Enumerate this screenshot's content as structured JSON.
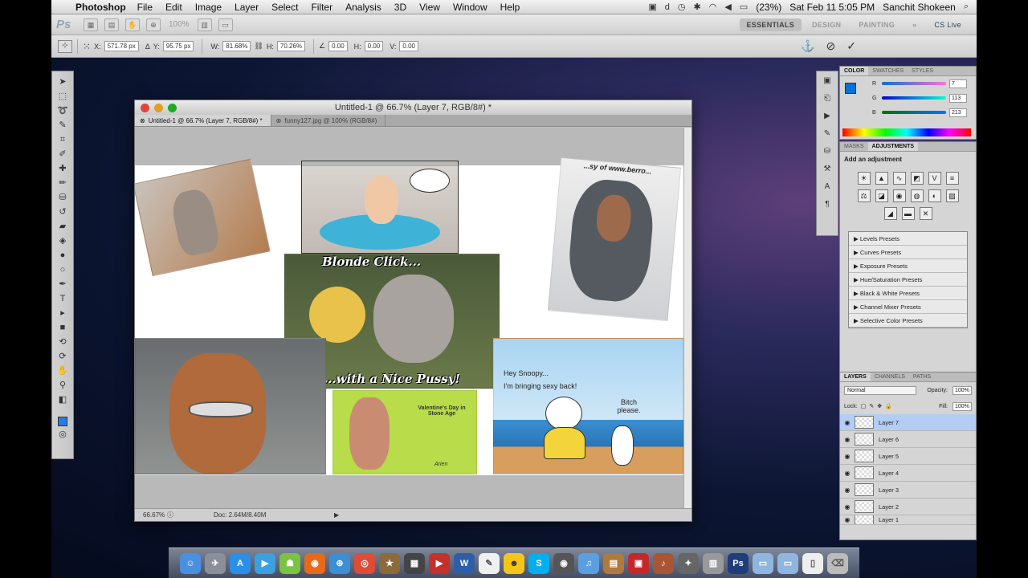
{
  "menubar": {
    "app": "Photoshop",
    "items": [
      "File",
      "Edit",
      "Image",
      "Layer",
      "Select",
      "Filter",
      "Analysis",
      "3D",
      "View",
      "Window",
      "Help"
    ],
    "battery": "(23%)",
    "clock": "Sat Feb 11  5:05 PM",
    "user": "Sanchit Shokeen"
  },
  "appbar": {
    "logo": "Ps",
    "zoom": "100%",
    "workspaces": [
      "ESSENTIALS",
      "DESIGN",
      "PAINTING"
    ],
    "cslive": "CS Live"
  },
  "options": {
    "x_label": "X:",
    "x_value": "571.78 px",
    "y_label": "Y:",
    "y_value": "95.75 px",
    "w_label": "W:",
    "w_value": "81.68%",
    "h_label": "H:",
    "h_value": "70.26%",
    "angle_value": "0.00",
    "hskew_label": "H:",
    "hskew_value": "0.00",
    "vskew_label": "V:",
    "vskew_value": "0.00"
  },
  "document": {
    "title": "Untitled-1 @ 66.7% (Layer 7, RGB/8#) *",
    "tabs": [
      "Untitled-1 @ 66.7% (Layer 7, RGB/8#) *",
      "funny127.jpg @ 100% (RGB/8#)"
    ],
    "zoom": "66.67%",
    "doc_size": "Doc: 2.64M/8.40M"
  },
  "canvas": {
    "caption_top": "Blonde Click...",
    "caption_bottom": "...with a Nice Pussy!",
    "watermark": "...sy of www.berro...",
    "cartoon_label": "Valentine's Day in Stone Age",
    "cartoon_sig": "Arien",
    "snoopy_line1": "Hey Snoopy...",
    "snoopy_line2": "I'm bringing sexy back!",
    "snoopy_reply": "Bitch please."
  },
  "color_panel": {
    "tabs": [
      "COLOR",
      "SWATCHES",
      "STYLES"
    ],
    "r_label": "R",
    "r": "7",
    "g_label": "G",
    "g": "113",
    "b_label": "B",
    "b": "213",
    "foreground": "#0771d5"
  },
  "adjustments": {
    "tabs": [
      "MASKS",
      "ADJUSTMENTS"
    ],
    "title": "Add an adjustment",
    "presets": [
      "Levels Presets",
      "Curves Presets",
      "Exposure Presets",
      "Hue/Saturation Presets",
      "Black & White Presets",
      "Channel Mixer Presets",
      "Selective Color Presets"
    ]
  },
  "layers": {
    "tabs": [
      "LAYERS",
      "CHANNELS",
      "PATHS"
    ],
    "blend": "Normal",
    "opacity_label": "Opacity:",
    "opacity": "100%",
    "lock_label": "Lock:",
    "fill_label": "Fill:",
    "fill": "100%",
    "items": [
      "Layer 7",
      "Layer 6",
      "Layer 5",
      "Layer 4",
      "Layer 3",
      "Layer 2",
      "Layer 1"
    ]
  },
  "dock": {
    "icons": [
      "finder",
      "launchpad",
      "app-store",
      "facetime",
      "android",
      "firefox",
      "safari",
      "chrome",
      "imovie",
      "clapper",
      "youtube",
      "word",
      "notes",
      "smiley",
      "skype",
      "camera",
      "itunes",
      "photos",
      "pdf",
      "guitar",
      "star",
      "trash-app",
      "ps",
      "folder",
      "folder2",
      "document",
      "trash"
    ]
  }
}
